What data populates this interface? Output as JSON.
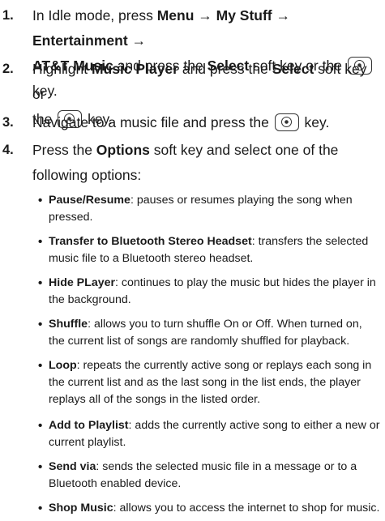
{
  "steps": [
    {
      "number": "1.",
      "line1": [
        "In Idle mode, press ",
        "Menu → My Stuff → Entertainment →"
      ],
      "line2": [
        "AT&T Music",
        " and press the ",
        "Select",
        " soft key or the ",
        " key."
      ]
    },
    {
      "number": "2.",
      "line1": [
        "Highlight ",
        "Music Player",
        " and press the ",
        "Select",
        " soft key or"
      ],
      "line2": [
        "the ",
        " key."
      ]
    },
    {
      "number": "3.",
      "line1": [
        "Navigate to a music file and press the ",
        " key."
      ]
    },
    {
      "number": "4.",
      "line1": [
        "Press the ",
        "Options",
        " soft key and select one of the"
      ],
      "line2": [
        "following options:"
      ]
    }
  ],
  "key_icon": "select-key-icon",
  "options": [
    {
      "name": "Pause/Resume",
      "desc": ": pauses or resumes playing the song when pressed."
    },
    {
      "name": "Transfer to Bluetooth Stereo Headset",
      "desc": ": transfers the selected music file to a Bluetooth stereo headset."
    },
    {
      "name": "Hide PLayer",
      "desc": ": continues to play the music but hides the player in the background."
    },
    {
      "name": "Shuffle",
      "desc": ": allows you to turn shuffle On or Off. When turned on, the current list of songs are randomly shuffled for playback."
    },
    {
      "name": "Loop",
      "desc": ": repeats the currently active song or replays each song in the current list and as the last song in the list ends, the player replays all of the songs in the listed order."
    },
    {
      "name": "Add to Playlist",
      "desc": ": adds the currently active song to either a new or current playlist."
    },
    {
      "name": "Send via",
      "desc": ": sends the selected music file in a message or to a Bluetooth enabled device."
    },
    {
      "name": "Shop Music",
      "desc": ": allows you to access the internet to shop for music."
    }
  ]
}
